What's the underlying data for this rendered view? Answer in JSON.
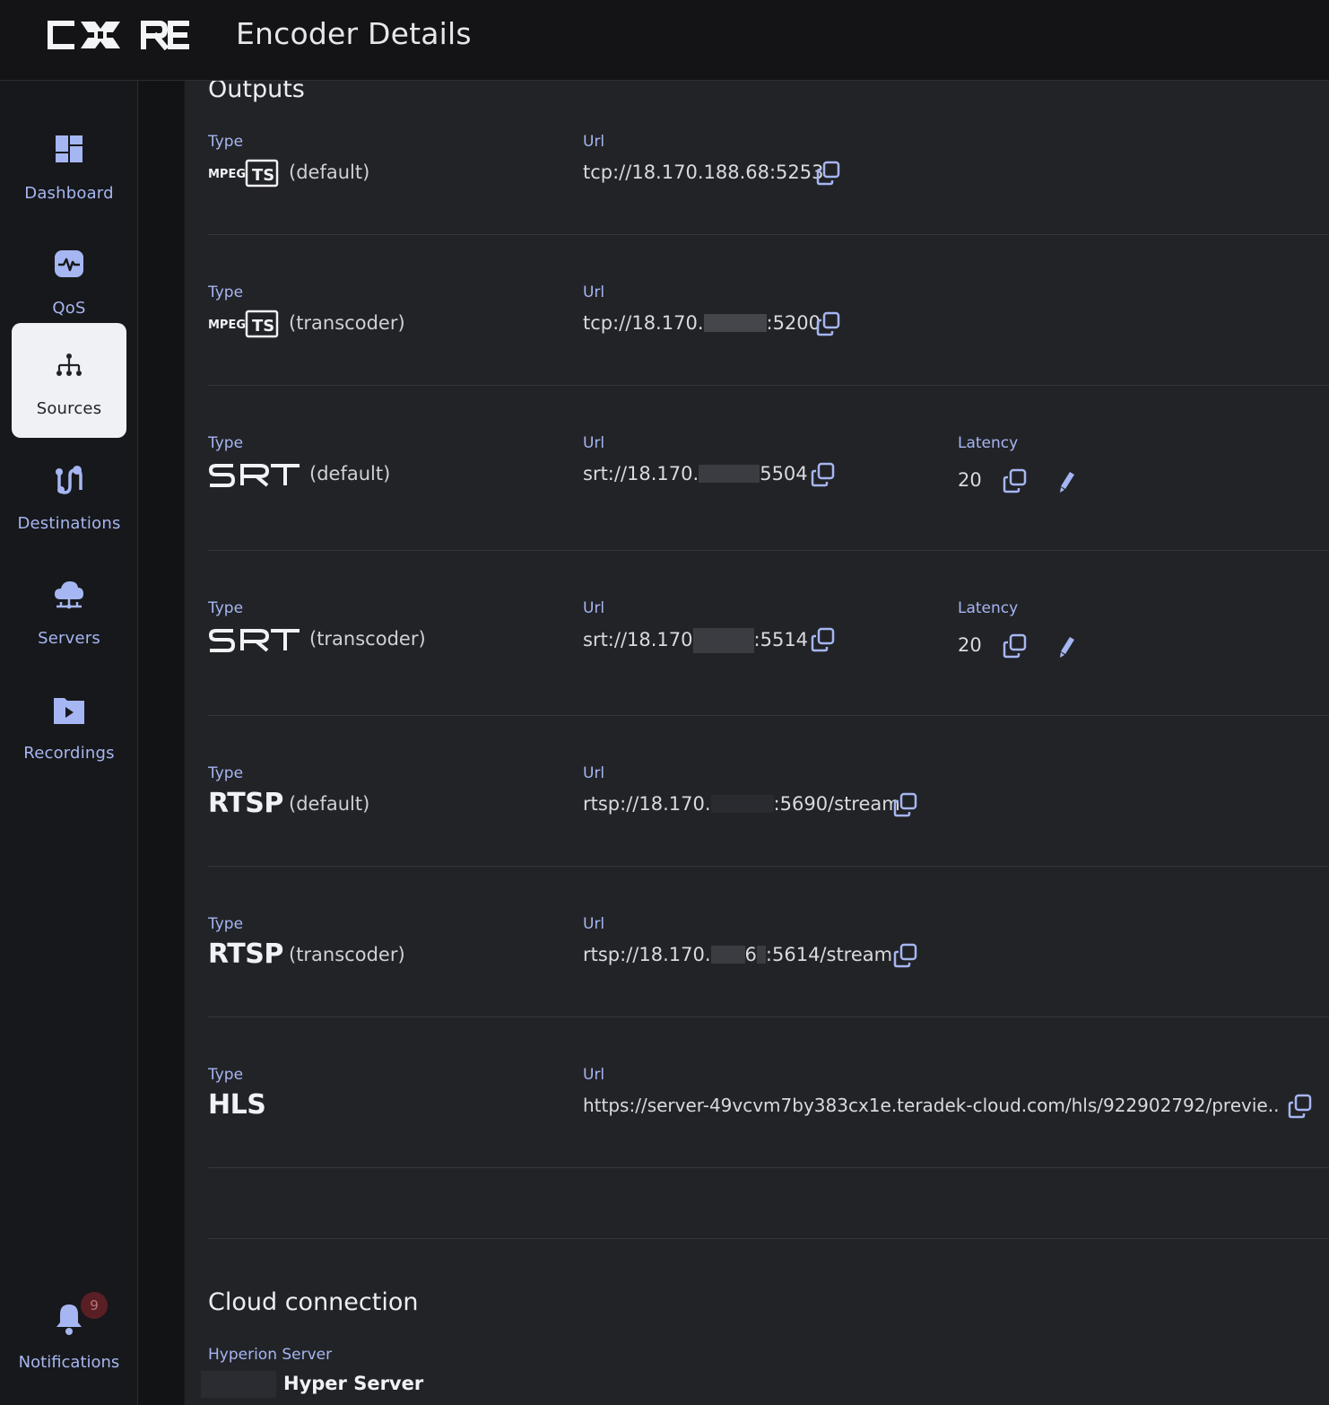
{
  "header": {
    "logo_text": "C✱RE",
    "title": "Encoder Details"
  },
  "sidebar": {
    "items": [
      {
        "label": "Dashboard",
        "icon": "dashboard-icon"
      },
      {
        "label": "QoS",
        "icon": "qos-icon"
      },
      {
        "label": "Sources",
        "icon": "sources-icon",
        "active": true
      },
      {
        "label": "Destinations",
        "icon": "destinations-icon"
      },
      {
        "label": "Servers",
        "icon": "servers-icon"
      },
      {
        "label": "Recordings",
        "icon": "recordings-icon"
      }
    ],
    "notifications": {
      "label": "Notifications",
      "count": "9"
    }
  },
  "outputs": {
    "title": "Outputs",
    "type_label": "Type",
    "url_label": "Url",
    "latency_label": "Latency",
    "rows": [
      {
        "type": "MPEG TS",
        "suffix": "(default)",
        "url": "tcp://18.170.188.68:5253"
      },
      {
        "type": "MPEG TS",
        "suffix": "(transcoder)",
        "url_start": "tcp://18.170.",
        "url_end": ":5200"
      },
      {
        "type": "SRT",
        "suffix": "(default)",
        "url_start": "srt://18.170.",
        "url_end": "5504",
        "latency": "20"
      },
      {
        "type": "SRT",
        "suffix": "(transcoder)",
        "url_start": "srt://18.170",
        "url_end": ":5514",
        "latency": "20"
      },
      {
        "type": "RTSP",
        "suffix": "(default)",
        "url_start": "rtsp://18.170.",
        "url_end": ":5690/stream"
      },
      {
        "type": "RTSP",
        "suffix": "(transcoder)",
        "url_start": "rtsp://18.170.",
        "url_mid": "6",
        "url_end": ":5614/stream"
      },
      {
        "type": "HLS",
        "suffix": "",
        "url": "https://server-49vcvm7by383cx1e.teradek-cloud.com/hls/922902792/previe..."
      }
    ]
  },
  "cloud": {
    "title": "Cloud connection",
    "server_label": "Hyperion Server",
    "server_name": "Hyper Server"
  },
  "colors": {
    "accent": "#a6b6f2",
    "background": "#222327",
    "sidebar": "#17181b",
    "badge": "#5a1f24"
  }
}
